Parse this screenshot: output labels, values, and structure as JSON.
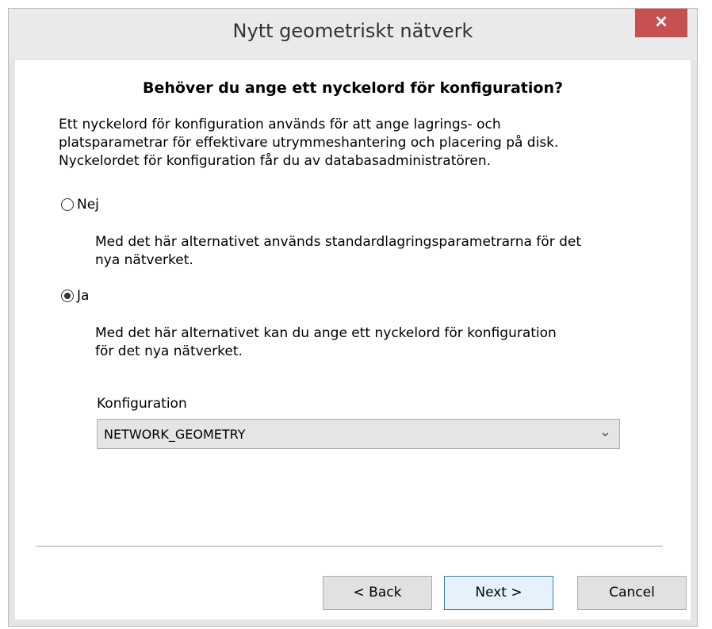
{
  "window": {
    "title": "Nytt geometriskt nätverk",
    "close_label": "×"
  },
  "heading": "Behöver du ange ett nyckelord för konfiguration?",
  "intro_lines": [
    "Ett nyckelord för konfiguration används för att ange lagrings- och",
    "platsparametrar för effektivare utrymmeshantering och placering på disk.",
    "Nyckelordet för konfiguration får du av databasadministratören."
  ],
  "options": [
    {
      "label": "Nej",
      "checked": false,
      "description_lines": [
        "Med det här alternativet används standardlagringsparametrarna för det",
        "nya nätverket."
      ]
    },
    {
      "label": "Ja",
      "checked": true,
      "description_lines": [
        "Med det här alternativet kan du ange ett nyckelord för konfiguration",
        "för det nya nätverket."
      ]
    }
  ],
  "configuration": {
    "label": "Konfiguration",
    "value": "NETWORK_GEOMETRY"
  },
  "buttons": {
    "back": "< Back",
    "next": "Next >",
    "cancel": "Cancel"
  },
  "colors": {
    "close_button": "#c75050",
    "default_button_border": "#3c7fb1"
  }
}
